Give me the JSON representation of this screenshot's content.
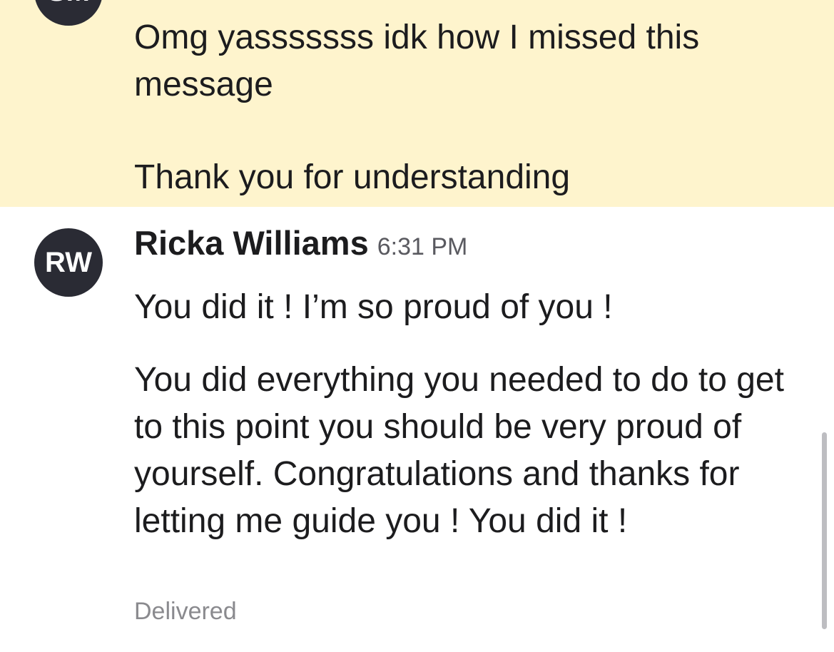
{
  "messages": [
    {
      "avatar_initials": "SM",
      "highlighted": true,
      "paragraphs": [
        "Omg yasssssss idk how I missed this message",
        "Thank you for understanding"
      ]
    },
    {
      "avatar_initials": "RW",
      "sender": "Ricka Williams",
      "time": "6:31 PM",
      "paragraphs": [
        "You did it ! I’m so proud of you !",
        "You did everything you needed to do to get to this point you should be very proud of yourself. Congratulations and thanks for letting me guide you ! You did it !"
      ],
      "status": "Delivered"
    }
  ],
  "colors": {
    "highlight_bg": "#fef4cd",
    "avatar_bg": "#2a2b34",
    "text": "#1c1c1e",
    "meta_text": "#8a8a8e"
  }
}
